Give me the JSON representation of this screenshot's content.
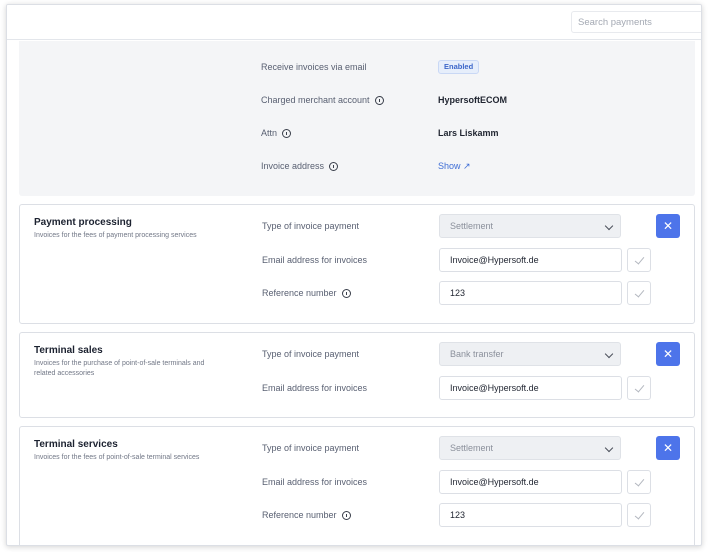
{
  "search": {
    "placeholder": "Search payments"
  },
  "summary": {
    "receive_email_label": "Receive invoices via email",
    "receive_email_badge": "Enabled",
    "merchant_label": "Charged merchant account",
    "merchant_value": "HypersoftECOM",
    "attn_label": "Attn",
    "attn_value": "Lars Liskamm",
    "address_label": "Invoice address",
    "address_link": "Show ↗"
  },
  "sections": [
    {
      "title": "Payment processing",
      "description": "Invoices for the fees of payment processing services",
      "type_label": "Type of invoice payment",
      "type_value": "Settlement",
      "email_label": "Email address for invoices",
      "email_value": "Invoice@Hypersoft.de",
      "ref_label": "Reference number",
      "ref_value": "123"
    },
    {
      "title": "Terminal sales",
      "description": "Invoices for the purchase of point-of-sale terminals and related accessories",
      "type_label": "Type of invoice payment",
      "type_value": "Bank transfer",
      "email_label": "Email address for invoices",
      "email_value": "Invoice@Hypersoft.de"
    },
    {
      "title": "Terminal services",
      "description": "Invoices for the fees of point-of-sale terminal services",
      "type_label": "Type of invoice payment",
      "type_value": "Settlement",
      "email_label": "Email address for invoices",
      "email_value": "Invoice@Hypersoft.de",
      "ref_label": "Reference number",
      "ref_value": "123"
    }
  ],
  "icons": {
    "info": "info-icon",
    "chevron": "chevron-down-icon",
    "check": "check-icon",
    "close": "close-icon",
    "external": "external-link-icon"
  },
  "colors": {
    "accent": "#4d74ea",
    "link": "#3f6ed6",
    "badge_bg": "#e6eefb",
    "panel_bg": "#f4f5f7"
  }
}
